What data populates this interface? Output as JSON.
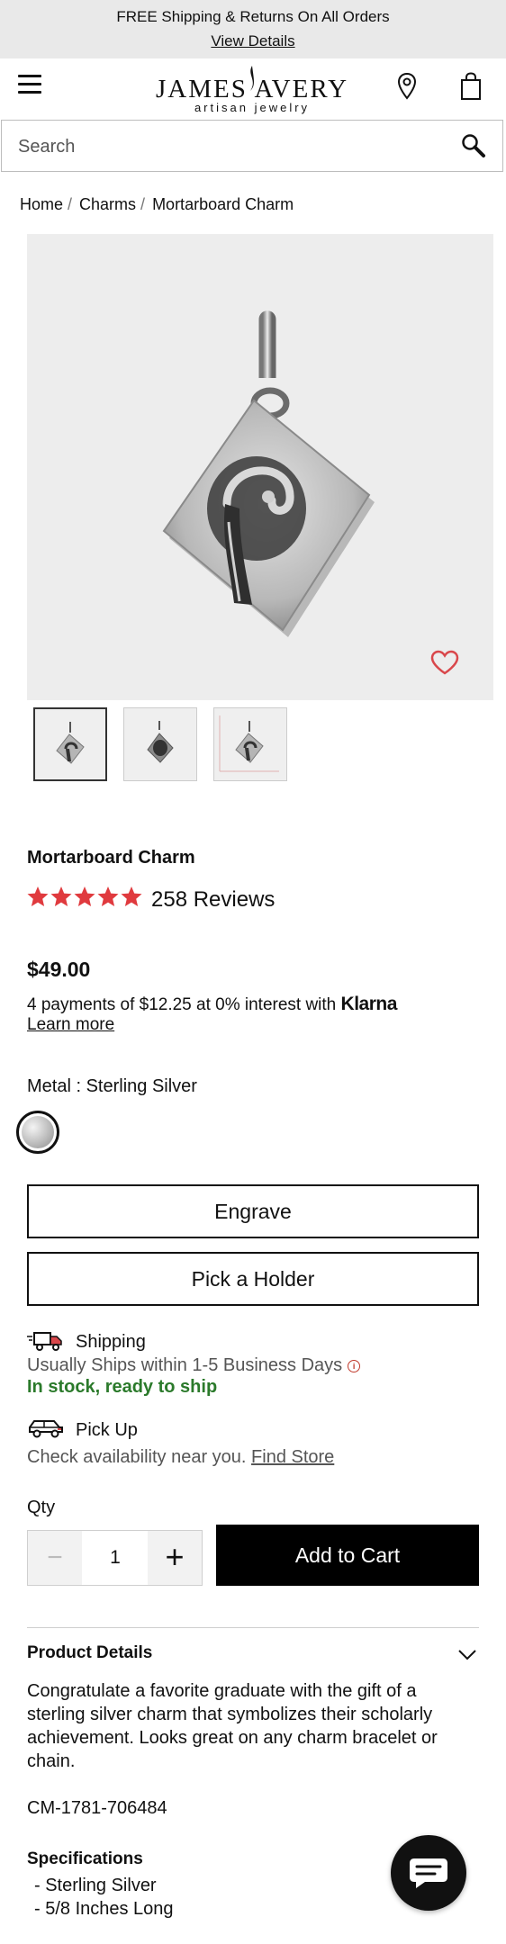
{
  "promo": {
    "line1": "FREE Shipping & Returns On All Orders",
    "line2": "View Details"
  },
  "header": {
    "logo_name": "JAMES AVERY",
    "logo_tagline": "artisan jewelry"
  },
  "search": {
    "placeholder": "Search"
  },
  "breadcrumb": {
    "items": [
      "Home",
      "Charms",
      "Mortarboard Charm"
    ]
  },
  "product": {
    "title": "Mortarboard Charm",
    "rating": 5,
    "reviews_label": "258 Reviews",
    "price": "$49.00",
    "klarna_text": "4 payments of $12.25 at 0% interest with",
    "klarna_brand": "Klarna",
    "learn_more": "Learn more",
    "metal_label": "Metal : Sterling Silver"
  },
  "actions": {
    "engrave": "Engrave",
    "pick_holder": "Pick a Holder"
  },
  "shipping": {
    "title": "Shipping",
    "detail": "Usually Ships within 1-5 Business Days",
    "stock": "In stock, ready to ship"
  },
  "pickup": {
    "title": "Pick Up",
    "detail": "Check availability near you.",
    "link": "Find Store"
  },
  "qty": {
    "label": "Qty",
    "value": "1"
  },
  "cart": {
    "label": "Add to Cart"
  },
  "details": {
    "title": "Product Details",
    "description": "Congratulate a favorite graduate with the gift of a sterling silver charm that symbolizes their scholarly achievement. Looks great on any charm bracelet or chain.",
    "sku": "CM-1781-706484",
    "spec_title": "Specifications",
    "specs": [
      "- Sterling Silver",
      "- 5/8 Inches Long"
    ]
  },
  "colors": {
    "star": "#e03a3e",
    "stock_green": "#2b7a2b",
    "heart": "#d9474b"
  }
}
